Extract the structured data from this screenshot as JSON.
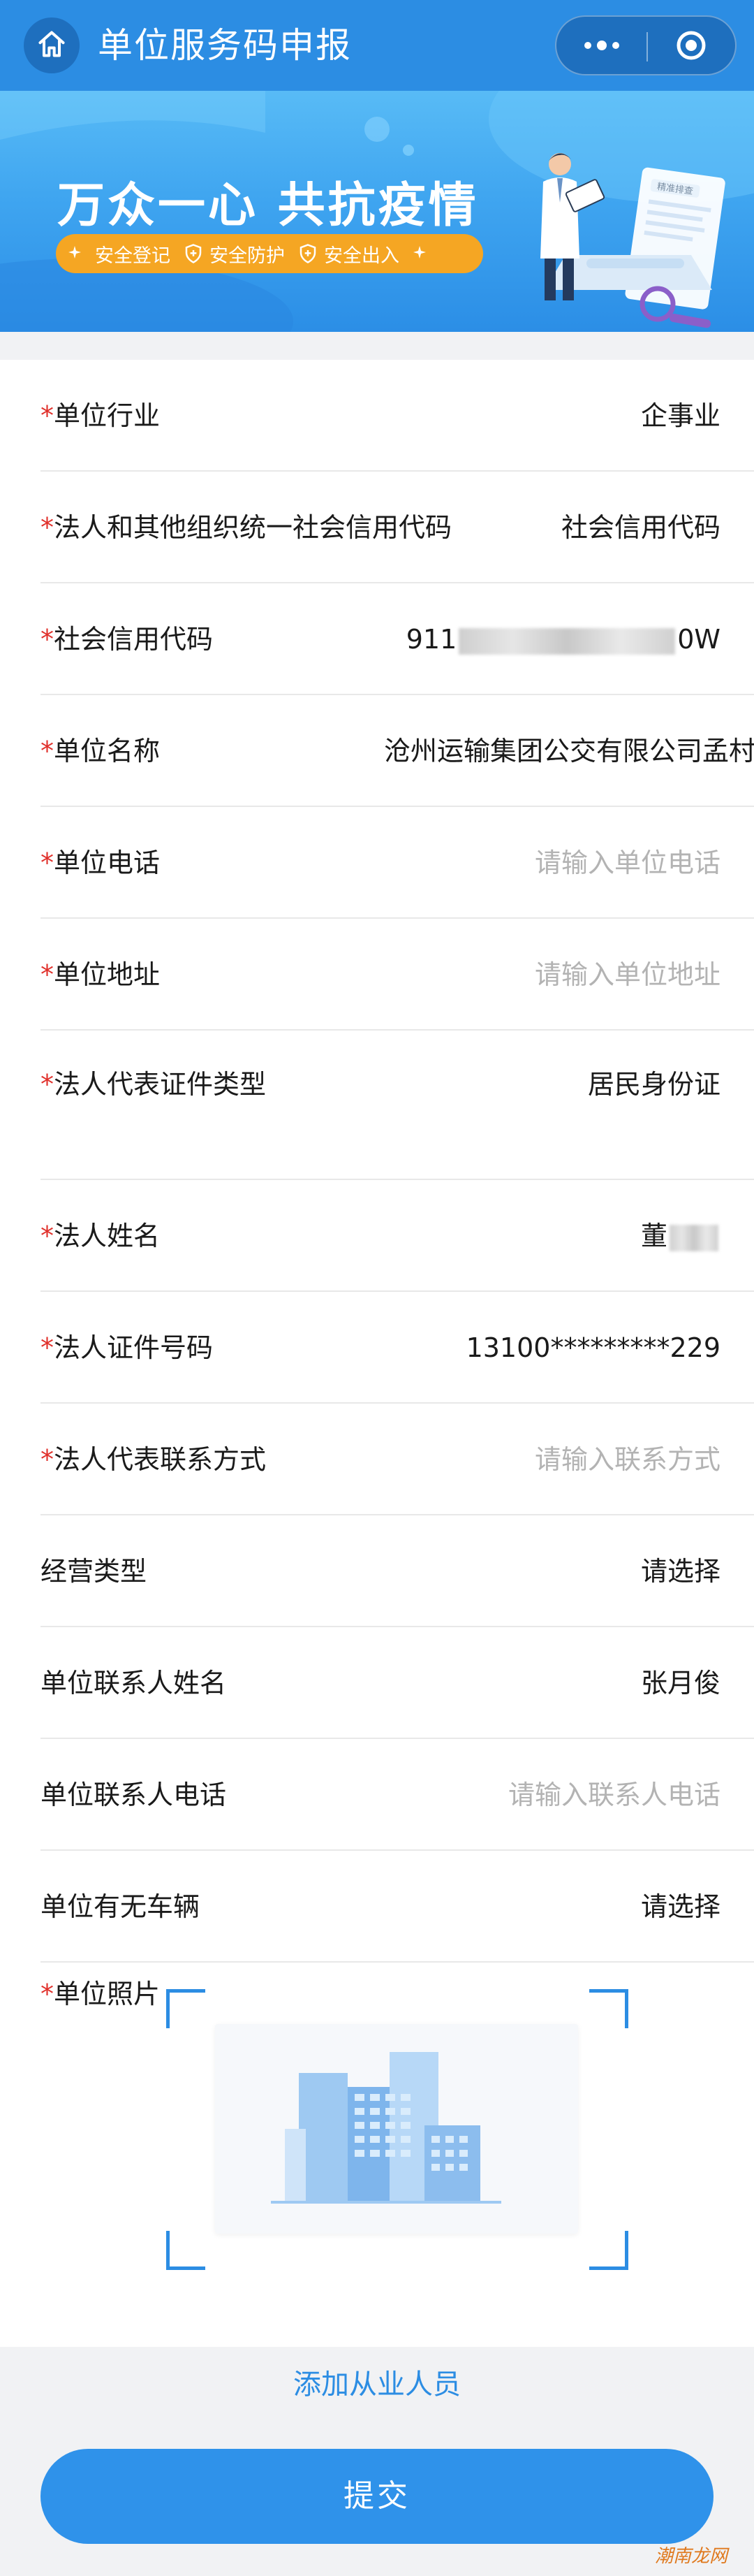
{
  "navbar": {
    "title": "单位服务码申报",
    "home_icon": "home-icon",
    "more_icon": "more-dots-icon",
    "close_icon": "target-close-icon",
    "background": "#2c8de3"
  },
  "banner": {
    "title": "万众一心  共抗疫情",
    "pills": [
      "安全登记",
      "安全防护",
      "安全出入"
    ],
    "document_label": "精准排查",
    "pill_color": "#f5a623"
  },
  "form": {
    "required_mark": "*",
    "rows": [
      {
        "label": "单位行业",
        "value": "企事业",
        "required": true
      },
      {
        "label": "法人和其他组织统一社会信用代码",
        "value": "社会信用代码",
        "required": true
      },
      {
        "label": "社会信用代码",
        "value_prefix": "911",
        "value_suffix": "0W",
        "required": true
      },
      {
        "label": "单位名称",
        "value": "沧州运输集团公交有限公司孟村",
        "required": true
      },
      {
        "label": "单位电话",
        "placeholder": "请输入单位电话",
        "required": true
      },
      {
        "label": "单位地址",
        "placeholder": "请输入单位地址",
        "required": true
      },
      {
        "label": "法人代表证件类型",
        "value": "居民身份证",
        "required": true
      },
      {
        "label": "法人姓名",
        "value": "董",
        "required": true
      },
      {
        "label": "法人证件号码",
        "value": "13100*********229",
        "required": true
      },
      {
        "label": "法人代表联系方式",
        "placeholder": "请输入联系方式",
        "required": true
      },
      {
        "label": "经营类型",
        "value": "请选择",
        "required": false
      },
      {
        "label": "单位联系人姓名",
        "value": "张月俊",
        "required": false
      },
      {
        "label": "单位联系人电话",
        "placeholder": "请输入联系人电话",
        "required": false
      },
      {
        "label": "单位有无车辆",
        "value": "请选择",
        "required": false
      }
    ],
    "photo": {
      "label": "单位照片",
      "required": true,
      "icon": "building-icon"
    }
  },
  "actions": {
    "add_staff": "添加从业人员",
    "submit": "提交"
  },
  "watermark": "潮南龙网",
  "colors": {
    "primary": "#2c8de3",
    "required": "#e0302b",
    "placeholder": "#b3b3b3"
  }
}
